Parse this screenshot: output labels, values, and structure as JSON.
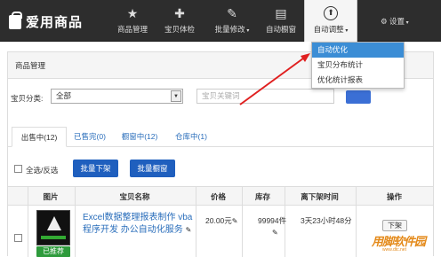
{
  "app": {
    "title": "爱用商品"
  },
  "nav": {
    "items": [
      {
        "label": "商品管理",
        "icon": "star-icon",
        "glyph": "★"
      },
      {
        "label": "宝贝体检",
        "icon": "medkit-icon",
        "glyph": "✚"
      },
      {
        "label": "批量修改",
        "icon": "edit-icon",
        "glyph": "✎"
      },
      {
        "label": "自动橱窗",
        "icon": "window-icon",
        "glyph": "▤"
      },
      {
        "label": "自动调整",
        "icon": "arrow-up-circle-icon",
        "glyph": "⬆"
      }
    ],
    "settings_label": "设置"
  },
  "dropdown": {
    "items": [
      "自动优化",
      "宝贝分布统计",
      "优化统计报表"
    ]
  },
  "panel": {
    "title": "商品管理"
  },
  "filter": {
    "label": "宝贝分类:",
    "category_value": "全部",
    "search_placeholder": "宝贝关键词"
  },
  "tabs": [
    "出售中(12)",
    "已售完(0)",
    "橱窗中(12)",
    "仓库中(1)"
  ],
  "actions": {
    "select_all": "全选/反选",
    "bulk_delist": "批量下架",
    "bulk_window": "批量橱窗"
  },
  "table": {
    "headers": [
      "图片",
      "宝贝名称",
      "价格",
      "库存",
      "离下架时间",
      "操作"
    ],
    "rows": [
      {
        "title": "Excel数据整理报表制作 vba程序开发 办公自动化服务",
        "price": "20.00元",
        "stock": "99994件",
        "time": "3天23小时48分",
        "action": "下架",
        "badge": "已推荐"
      }
    ]
  },
  "watermark": {
    "text": "用脚软件园",
    "sub": "www.dtc.net"
  },
  "colors": {
    "topbar": "#2d2d2d",
    "accent": "#1f5fbe",
    "link": "#2a6ebb",
    "arrow": "#e02020"
  }
}
